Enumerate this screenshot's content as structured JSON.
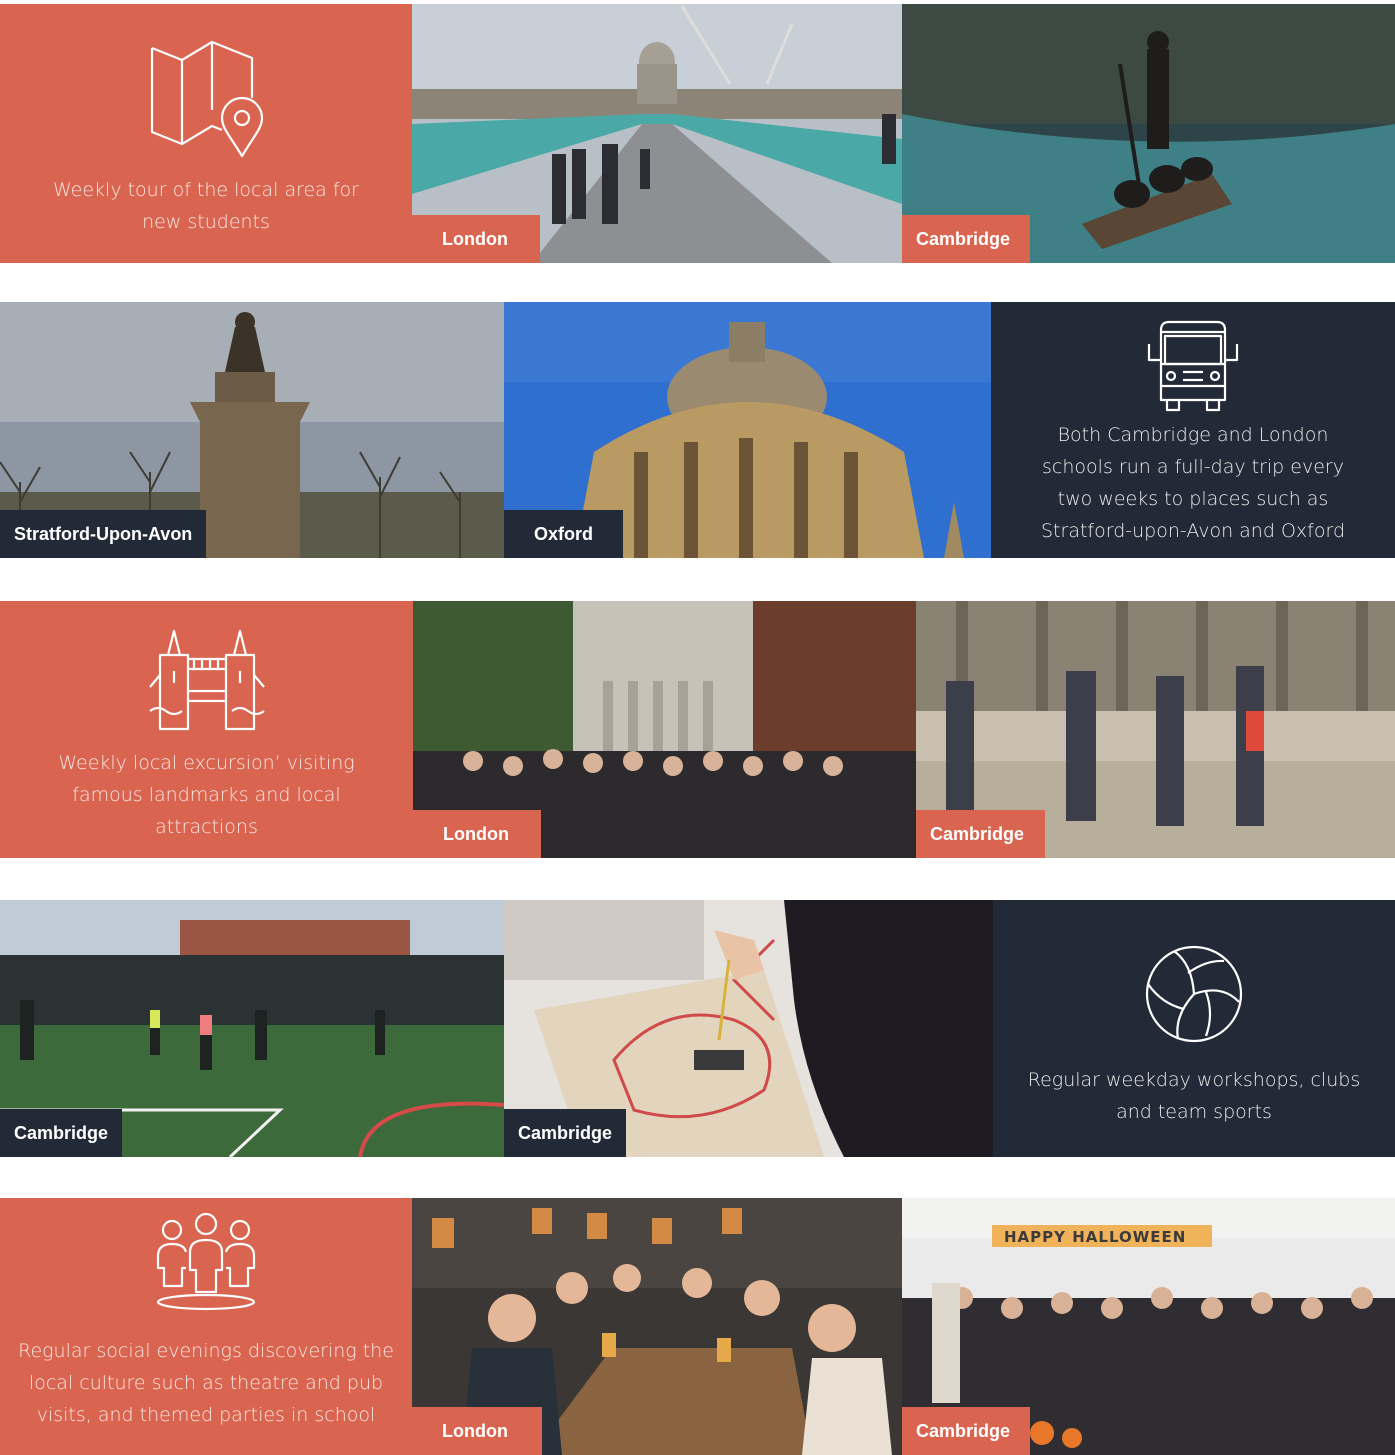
{
  "colors": {
    "coral": "#d9644f",
    "navy": "#232a37",
    "text": "#ffffff"
  },
  "rows": [
    {
      "panel": {
        "icon": "map-pin-icon",
        "text": "Weekly tour of the local area for new students"
      },
      "photos": [
        {
          "label": "London",
          "scene": "millennium-bridge"
        },
        {
          "label": "Cambridge",
          "scene": "punting-on-river"
        }
      ]
    },
    {
      "photos": [
        {
          "label": "Stratford-Upon-Avon",
          "scene": "statue-monument"
        },
        {
          "label": "Oxford",
          "scene": "radcliffe-camera"
        }
      ],
      "panel": {
        "icon": "bus-icon",
        "text": "Both Cambridge and London schools run a full-day trip every two weeks to places such as Stratford-upon-Avon and Oxford"
      }
    },
    {
      "panel": {
        "icon": "tower-bridge-icon",
        "text": "Weekly local excursion’ visiting famous landmarks and local attractions"
      },
      "photos": [
        {
          "label": "London",
          "scene": "group-at-cathedral"
        },
        {
          "label": "Cambridge",
          "scene": "students-in-courtyard"
        }
      ]
    },
    {
      "photos": [
        {
          "label": "Cambridge",
          "scene": "football-pitch"
        },
        {
          "label": "Cambridge",
          "scene": "painting-tote-bag"
        }
      ],
      "panel": {
        "icon": "volleyball-icon",
        "text": "Regular weekday workshops, clubs and team sports"
      }
    },
    {
      "panel": {
        "icon": "people-group-icon",
        "text": "Regular social evenings discovering the local culture such as theatre and pub visits, and themed parties in school"
      },
      "photos": [
        {
          "label": "London",
          "scene": "pub-evening"
        },
        {
          "label": "Cambridge",
          "scene": "halloween-party"
        }
      ],
      "banner": "HAPPY HALLOWEEN"
    }
  ]
}
